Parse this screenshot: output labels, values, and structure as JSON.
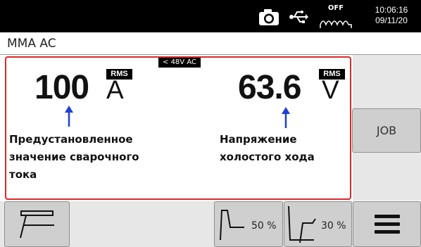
{
  "status_bar": {
    "icons": [
      "camera-icon",
      "usb-icon",
      "voltage-reduction-off-icon"
    ],
    "vrd_label": "OFF",
    "time": "10:06:16",
    "date": "09/11/20"
  },
  "mode": {
    "label": "MMA AC"
  },
  "main": {
    "voltage_limit": "< 48V AC",
    "current": {
      "value": "100",
      "unit": "A",
      "tag": "RMS"
    },
    "voltage": {
      "value": "63.6",
      "unit": "V",
      "tag": "RMS"
    },
    "annotation_current": [
      "Предустановленное",
      "значение сварочного",
      "тока"
    ],
    "annotation_voltage": [
      "Напряжение",
      "холостого хода"
    ],
    "accent_color": "#d82a2a",
    "arrow_color": "#1f3fd6"
  },
  "side": {
    "job_label": "JOB"
  },
  "bottom": {
    "torch_icon": "electrode-holder-icon",
    "hot_start": {
      "icon": "hot-start-icon",
      "value": "50 %"
    },
    "arc_force": {
      "icon": "arc-force-icon",
      "value": "30 %"
    },
    "menu_icon": "hamburger-menu-icon"
  }
}
